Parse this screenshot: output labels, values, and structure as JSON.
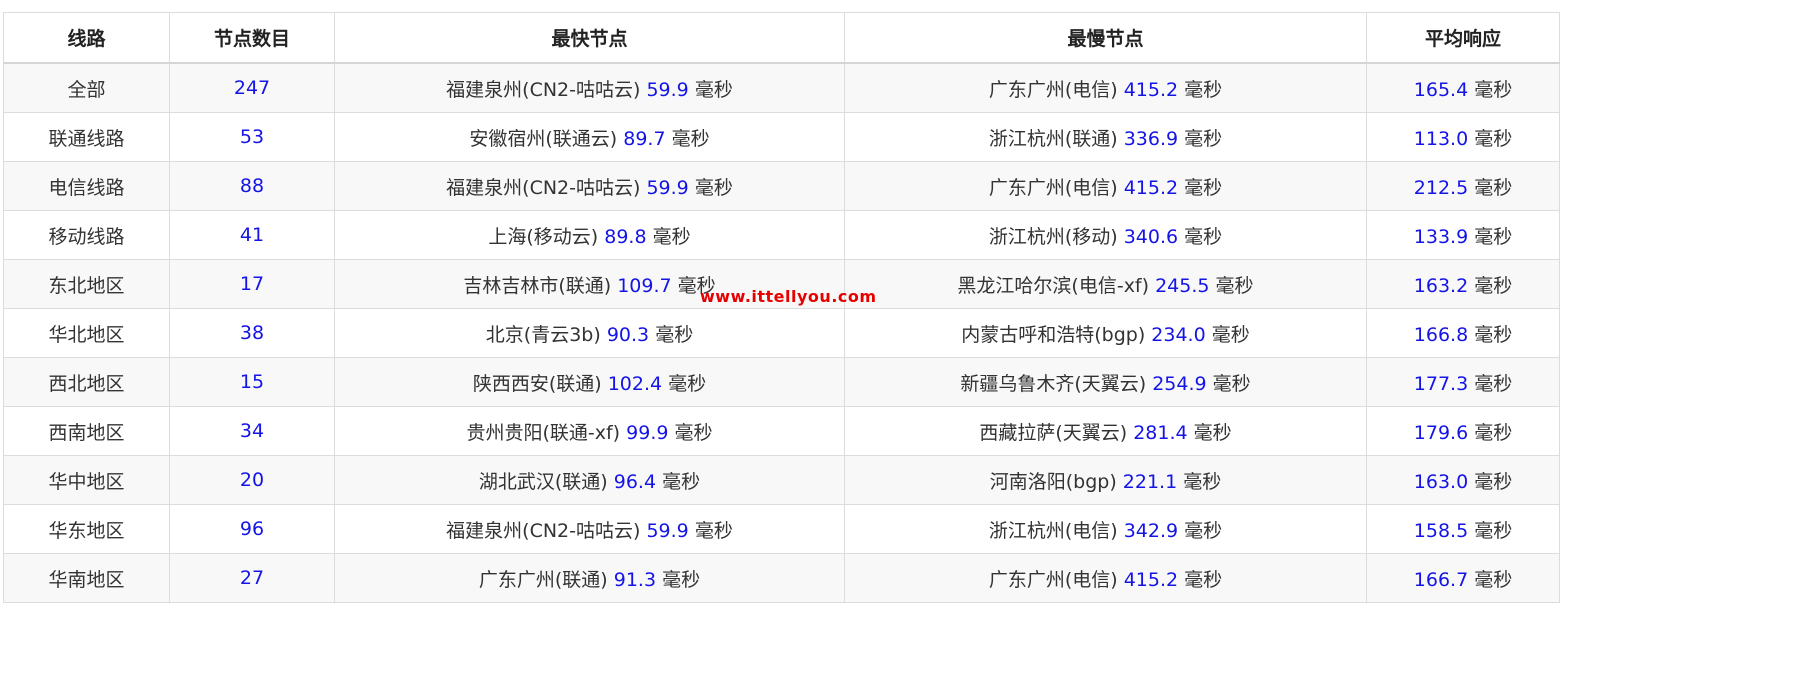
{
  "table": {
    "headers": [
      "线路",
      "节点数目",
      "最快节点",
      "最慢节点",
      "平均响应"
    ],
    "rows": [
      {
        "route": "全部",
        "count": "247",
        "fast_name": "福建泉州(CN2-咕咕云)",
        "fast_val": "59.9",
        "slow_name": "广东广州(电信)",
        "slow_val": "415.2",
        "avg_val": "165.4"
      },
      {
        "route": "联通线路",
        "count": "53",
        "fast_name": "安徽宿州(联通云)",
        "fast_val": "89.7",
        "slow_name": "浙江杭州(联通)",
        "slow_val": "336.9",
        "avg_val": "113.0"
      },
      {
        "route": "电信线路",
        "count": "88",
        "fast_name": "福建泉州(CN2-咕咕云)",
        "fast_val": "59.9",
        "slow_name": "广东广州(电信)",
        "slow_val": "415.2",
        "avg_val": "212.5"
      },
      {
        "route": "移动线路",
        "count": "41",
        "fast_name": "上海(移动云)",
        "fast_val": "89.8",
        "slow_name": "浙江杭州(移动)",
        "slow_val": "340.6",
        "avg_val": "133.9"
      },
      {
        "route": "东北地区",
        "count": "17",
        "fast_name": "吉林吉林市(联通)",
        "fast_val": "109.7",
        "slow_name": "黑龙江哈尔滨(电信-xf)",
        "slow_val": "245.5",
        "avg_val": "163.2"
      },
      {
        "route": "华北地区",
        "count": "38",
        "fast_name": "北京(青云3b)",
        "fast_val": "90.3",
        "slow_name": "内蒙古呼和浩特(bgp)",
        "slow_val": "234.0",
        "avg_val": "166.8"
      },
      {
        "route": "西北地区",
        "count": "15",
        "fast_name": "陕西西安(联通)",
        "fast_val": "102.4",
        "slow_name": "新疆乌鲁木齐(天翼云)",
        "slow_val": "254.9",
        "avg_val": "177.3"
      },
      {
        "route": "西南地区",
        "count": "34",
        "fast_name": "贵州贵阳(联通-xf)",
        "fast_val": "99.9",
        "slow_name": "西藏拉萨(天翼云)",
        "slow_val": "281.4",
        "avg_val": "179.6"
      },
      {
        "route": "华中地区",
        "count": "20",
        "fast_name": "湖北武汉(联通)",
        "fast_val": "96.4",
        "slow_name": "河南洛阳(bgp)",
        "slow_val": "221.1",
        "avg_val": "163.0"
      },
      {
        "route": "华东地区",
        "count": "96",
        "fast_name": "福建泉州(CN2-咕咕云)",
        "fast_val": "59.9",
        "slow_name": "浙江杭州(电信)",
        "slow_val": "342.9",
        "avg_val": "158.5"
      },
      {
        "route": "华南地区",
        "count": "27",
        "fast_name": "广东广州(联通)",
        "fast_val": "91.3",
        "slow_name": "广东广州(电信)",
        "slow_val": "415.2",
        "avg_val": "166.7"
      }
    ]
  },
  "unit": "毫秒",
  "watermark": "www.ittellyou.com",
  "colors": {
    "number": "#1414e6",
    "text": "#333333",
    "watermark": "#e60000",
    "stripe": "#f8f8f8"
  }
}
